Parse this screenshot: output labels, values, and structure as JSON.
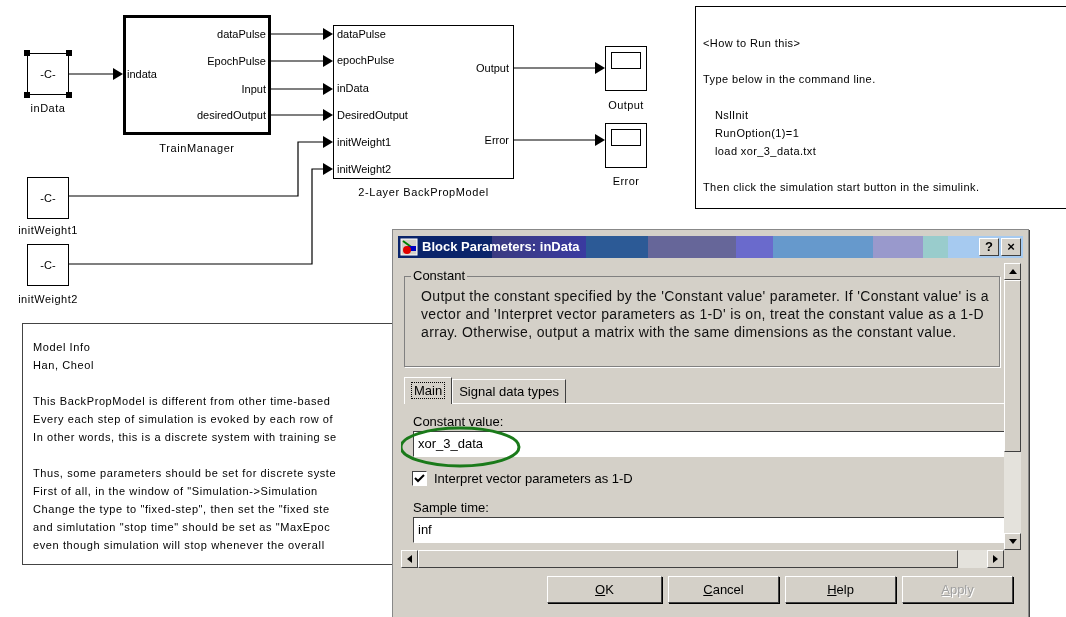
{
  "diagram": {
    "constants": [
      {
        "symbol": "-C-",
        "label": "inData",
        "selected": true
      },
      {
        "symbol": "-C-",
        "label": "initWeight1",
        "selected": false
      },
      {
        "symbol": "-C-",
        "label": "initWeight2",
        "selected": false
      }
    ],
    "subsystems": [
      {
        "label": "TrainManager",
        "inputs": [
          "indata"
        ],
        "outputs": [
          "dataPulse",
          "EpochPulse",
          "Input",
          "desiredOutput"
        ]
      },
      {
        "label": "2-Layer BackPropModel",
        "inputs": [
          "dataPulse",
          "epochPulse",
          "inData",
          "DesiredOutput",
          "initWeight1",
          "initWeight2"
        ],
        "outputs": [
          "Output",
          "Error"
        ]
      }
    ],
    "scopes": [
      {
        "label": "Output"
      },
      {
        "label": "Error"
      }
    ],
    "run_note": [
      {
        "kind": "text",
        "text": "<How to Run this>"
      },
      {
        "kind": "gap"
      },
      {
        "kind": "text",
        "text": "Type below in the command line."
      },
      {
        "kind": "gap"
      },
      {
        "kind": "command",
        "text": "NslInit"
      },
      {
        "kind": "command",
        "text": "RunOption(1)=1"
      },
      {
        "kind": "command",
        "text": "load xor_3_data.txt"
      },
      {
        "kind": "gap"
      },
      {
        "kind": "text",
        "text": "Then click the simulation start button in the simulink."
      }
    ],
    "model_info": [
      {
        "kind": "text",
        "text": "Model Info"
      },
      {
        "kind": "text",
        "text": "Han, Cheol"
      },
      {
        "kind": "gap"
      },
      {
        "kind": "text",
        "text": "This BackPropModel is different from other time-based"
      },
      {
        "kind": "text",
        "text": "Every each step of simulation is evoked by each row of"
      },
      {
        "kind": "text",
        "text": "In other words, this is a discrete system with training se"
      },
      {
        "kind": "gap"
      },
      {
        "kind": "text",
        "text": "Thus, some parameters should be set for discrete syste"
      },
      {
        "kind": "text",
        "text": "First of all, in the window of \"Simulation->Simulation"
      },
      {
        "kind": "text",
        "text": "Change the type to \"fixed-step\", then set the \"fixed ste"
      },
      {
        "kind": "text",
        "text": "and simlutation \"stop time\" should be set as \"MaxEpoc"
      },
      {
        "kind": "text",
        "text": "even though simulation will stop whenever the overall"
      }
    ]
  },
  "dialog": {
    "title": "Block Parameters: inData",
    "title_buttons": [
      "?",
      "×"
    ],
    "group": "Constant",
    "description": "Output the constant specified by the 'Constant value' parameter. If 'Constant value' is a vector and 'Interpret vector parameters as 1-D' is on, treat the constant value as a 1-D array. Otherwise, output a matrix with the same dimensions as the constant value.",
    "tabs": [
      {
        "label": "Main",
        "selected": true
      },
      {
        "label": "Signal data types",
        "selected": false
      }
    ],
    "constant_value": {
      "label": "Constant value:",
      "value": "xor_3_data",
      "highlighted": true
    },
    "interpret_vector": {
      "label": "Interpret vector parameters as 1-D",
      "checked": true
    },
    "sample_time": {
      "label": "Sample time:",
      "value": "inf"
    },
    "buttons": [
      {
        "label": "OK",
        "disabled": false
      },
      {
        "label": "Cancel",
        "disabled": false
      },
      {
        "label": "Help",
        "disabled": false
      },
      {
        "label": "Apply",
        "disabled": true
      }
    ]
  }
}
